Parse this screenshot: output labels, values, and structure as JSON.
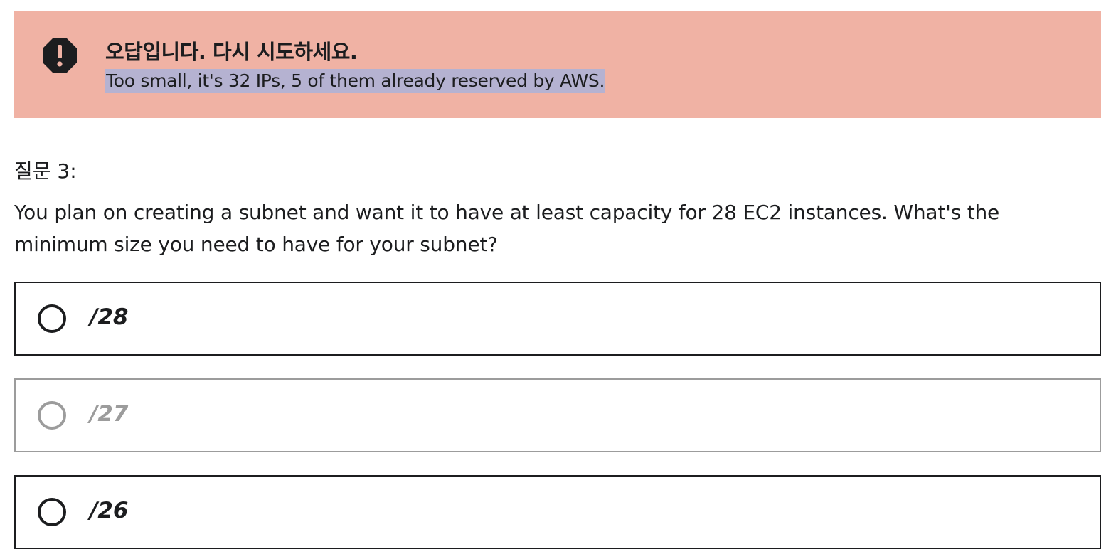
{
  "alert": {
    "icon": "exclamation-octagon-icon",
    "title": "오답입니다. 다시 시도하세요.",
    "message": "Too small, it's 32 IPs, 5 of them already reserved by AWS.",
    "background": "#f0b2a4",
    "highlight": "#b5b2d1"
  },
  "question": {
    "number": "질문 3:",
    "text": "You plan on creating a subnet and want it to have at least capacity for 28 EC2 instances. What's the minimum size you need to have for your subnet?"
  },
  "options": [
    {
      "label": "/28",
      "disabled": false
    },
    {
      "label": "/27",
      "disabled": true
    },
    {
      "label": "/26",
      "disabled": false
    }
  ],
  "colors": {
    "text": "#1c1d1f",
    "disabled": "#9c9c9c"
  }
}
